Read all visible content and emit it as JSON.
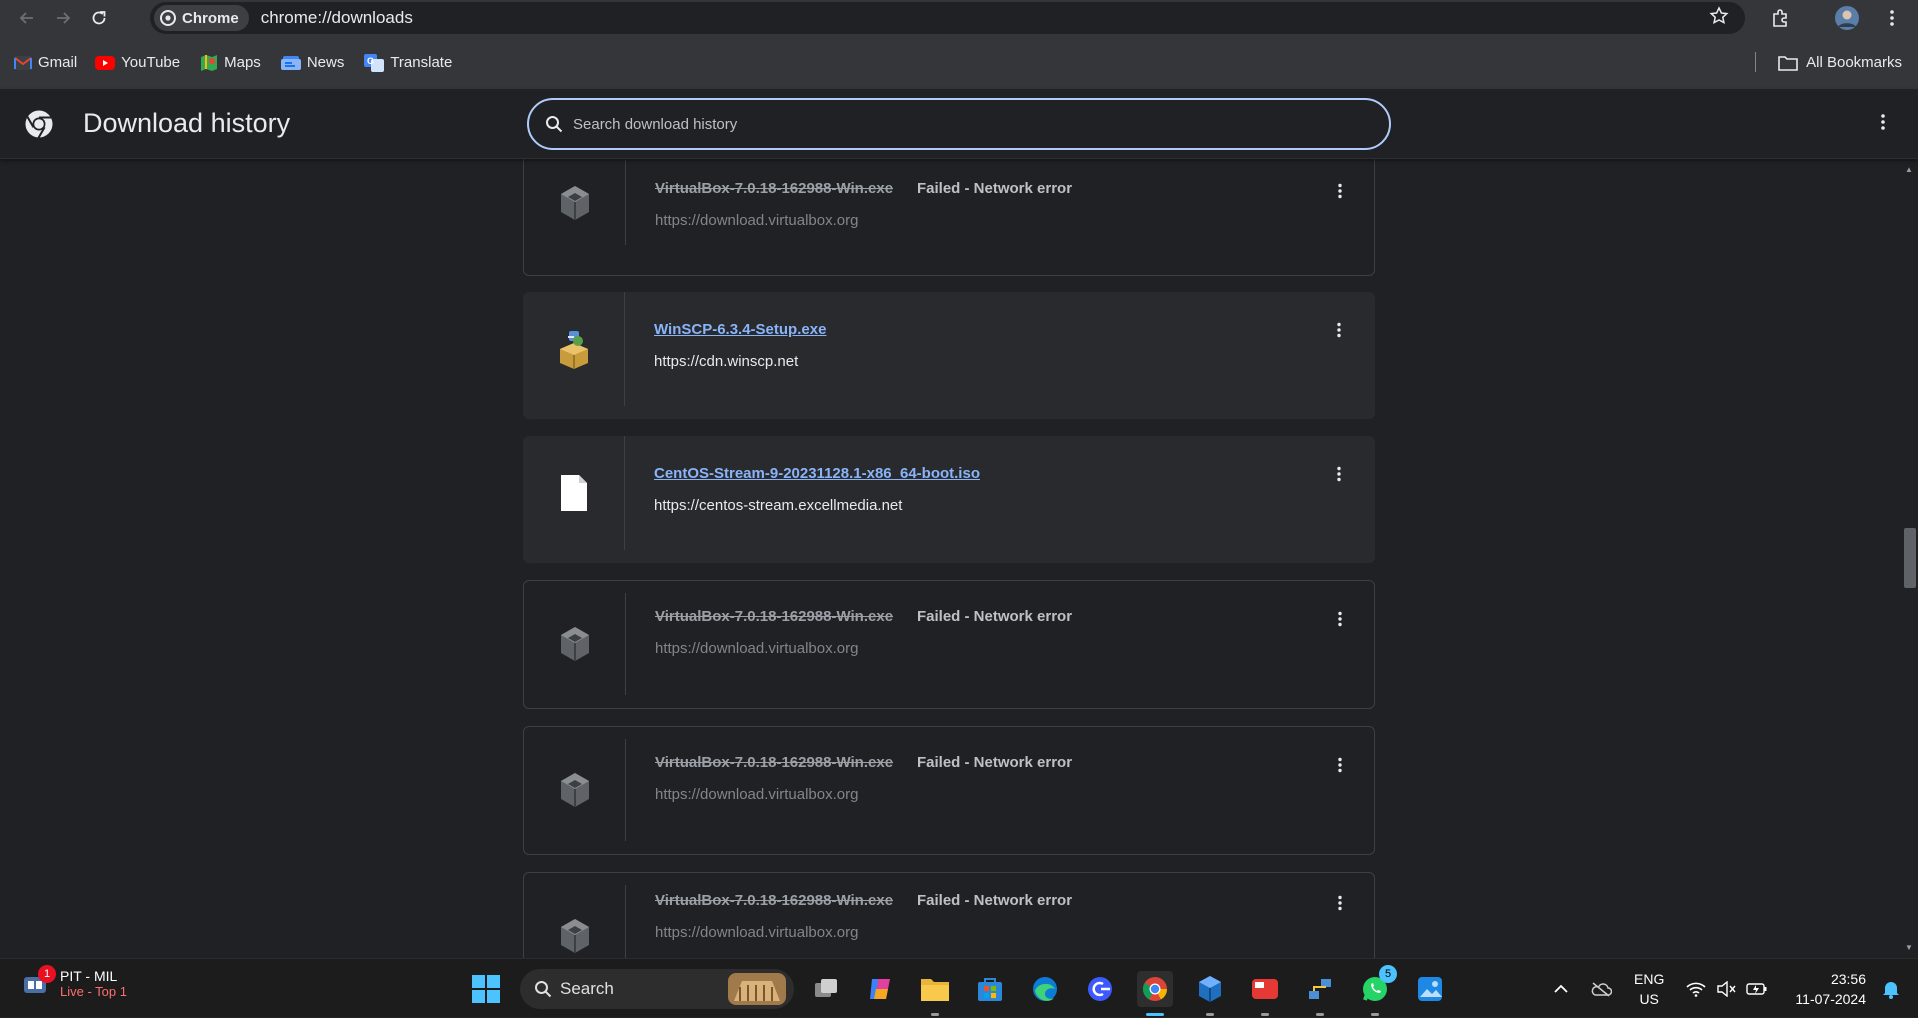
{
  "browser": {
    "chip_label": "Chrome",
    "url": "chrome://downloads"
  },
  "bookmarks": {
    "items": [
      {
        "label": "Gmail",
        "icon": "gmail-icon",
        "color": "#ea4335"
      },
      {
        "label": "YouTube",
        "icon": "youtube-icon",
        "color": "#ff0000"
      },
      {
        "label": "Maps",
        "icon": "maps-icon",
        "color": "#34a853"
      },
      {
        "label": "News",
        "icon": "news-icon",
        "color": "#4285f4"
      },
      {
        "label": "Translate",
        "icon": "translate-icon",
        "color": "#4285f4"
      }
    ],
    "all_label": "All Bookmarks"
  },
  "page": {
    "title": "Download history",
    "search_placeholder": "Search download history"
  },
  "downloads": [
    {
      "name": "VirtualBox-7.0.18-162988-Win.exe",
      "status": "Failed - Network error",
      "url": "https://download.virtualbox.org",
      "failed": true,
      "icon": "virtualbox-file-icon"
    },
    {
      "name": "WinSCP-6.3.4-Setup.exe",
      "status": "",
      "url": "https://cdn.winscp.net",
      "failed": false,
      "icon": "winscp-installer-icon"
    },
    {
      "name": "CentOS-Stream-9-20231128.1-x86_64-boot.iso",
      "status": "",
      "url": "https://centos-stream.excellmedia.net",
      "failed": false,
      "icon": "document-file-icon"
    },
    {
      "name": "VirtualBox-7.0.18-162988-Win.exe",
      "status": "Failed - Network error",
      "url": "https://download.virtualbox.org",
      "failed": true,
      "icon": "virtualbox-file-icon"
    },
    {
      "name": "VirtualBox-7.0.18-162988-Win.exe",
      "status": "Failed - Network error",
      "url": "https://download.virtualbox.org",
      "failed": true,
      "icon": "virtualbox-file-icon"
    },
    {
      "name": "VirtualBox-7.0.18-162988-Win.exe",
      "status": "Failed - Network error",
      "url": "https://download.virtualbox.org",
      "failed": true,
      "icon": "virtualbox-file-icon"
    }
  ],
  "taskbar": {
    "weather_title": "PIT - MIL",
    "weather_subtitle": "Live - Top 1",
    "weather_badge": "1",
    "search_label": "Search",
    "whatsapp_badge": "5",
    "lang_line1": "ENG",
    "lang_line2": "US",
    "time": "23:56",
    "date": "11-07-2024"
  }
}
